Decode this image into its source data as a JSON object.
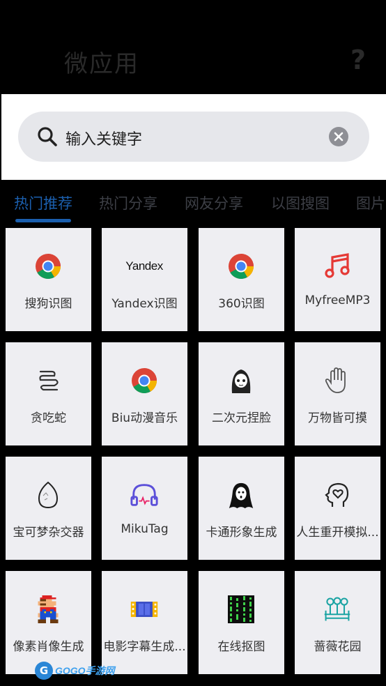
{
  "header": {
    "title": "微应用",
    "help_label": "?"
  },
  "search": {
    "value": "输入关键字"
  },
  "tabs": [
    {
      "label": "热门推荐",
      "active": true
    },
    {
      "label": "热门分享",
      "active": false
    },
    {
      "label": "网友分享",
      "active": false
    },
    {
      "label": "以图搜图",
      "active": false
    },
    {
      "label": "图片",
      "active": false
    }
  ],
  "apps": [
    {
      "label": "搜狗识图",
      "icon": "chrome-icon"
    },
    {
      "label": "Yandex识图",
      "icon": "yandex-logo-icon",
      "icon_text": "Yandex"
    },
    {
      "label": "360识图",
      "icon": "chrome-icon"
    },
    {
      "label": "MyfreeMP3",
      "icon": "music-note-icon"
    },
    {
      "label": "贪吃蛇",
      "icon": "snake-icon"
    },
    {
      "label": "Biu动漫音乐",
      "icon": "chrome-icon"
    },
    {
      "label": "二次元捏脸",
      "icon": "anime-face-icon"
    },
    {
      "label": "万物皆可摸",
      "icon": "hand-icon"
    },
    {
      "label": "宝可梦杂交器",
      "icon": "egg-icon"
    },
    {
      "label": "MikuTag",
      "icon": "headphones-icon"
    },
    {
      "label": "卡通形象生成",
      "icon": "ghost-icon"
    },
    {
      "label": "人生重开模拟...",
      "icon": "head-heart-icon"
    },
    {
      "label": "像素肖像生成",
      "icon": "pixel-mario-icon"
    },
    {
      "label": "电影字幕生成...",
      "icon": "film-icon"
    },
    {
      "label": "在线抠图",
      "icon": "matrix-icon"
    },
    {
      "label": "蔷薇花园",
      "icon": "garden-icon"
    }
  ],
  "watermark": {
    "logo_letter": "G",
    "text": "GOGO手游网"
  },
  "colors": {
    "accent": "#1b5fae",
    "tile_bg": "#eeeef2",
    "search_bg": "#e6e7eb",
    "music_red": "#e53935",
    "headphones_purple": "#5b4fd9",
    "garden_teal": "#1aa3a3"
  }
}
